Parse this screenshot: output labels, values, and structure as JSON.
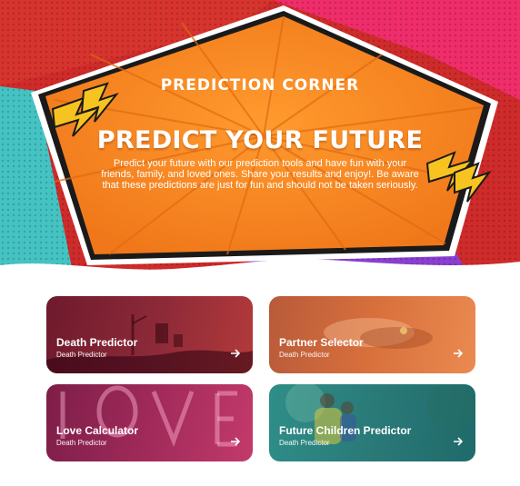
{
  "hero": {
    "logo": "PREDICTION CORNER",
    "title": "PREDICT YOUR FUTURE",
    "description": "Predict your future with our prediction tools and have fun with your friends, family, and loved ones. Share your results and enjoy!. Be aware that these predictions are just for fun and should not be taken seriously.",
    "colors": {
      "orange": "#f7881f",
      "teal": "#45c3c3",
      "pink": "#ef2d6a",
      "red": "#cf2b2b",
      "purple": "#8a3fd0"
    }
  },
  "cards": [
    {
      "title": "Death Predictor",
      "subtitle": "Death Predictor",
      "icon": "arrow-right-icon"
    },
    {
      "title": "Partner Selector",
      "subtitle": "Death Predictor",
      "icon": "arrow-right-icon"
    },
    {
      "title": "Love Calculator",
      "subtitle": "Death Predictor",
      "icon": "arrow-right-icon"
    },
    {
      "title": "Future Children Predictor",
      "subtitle": "Death Predictor",
      "icon": "arrow-right-icon"
    }
  ]
}
